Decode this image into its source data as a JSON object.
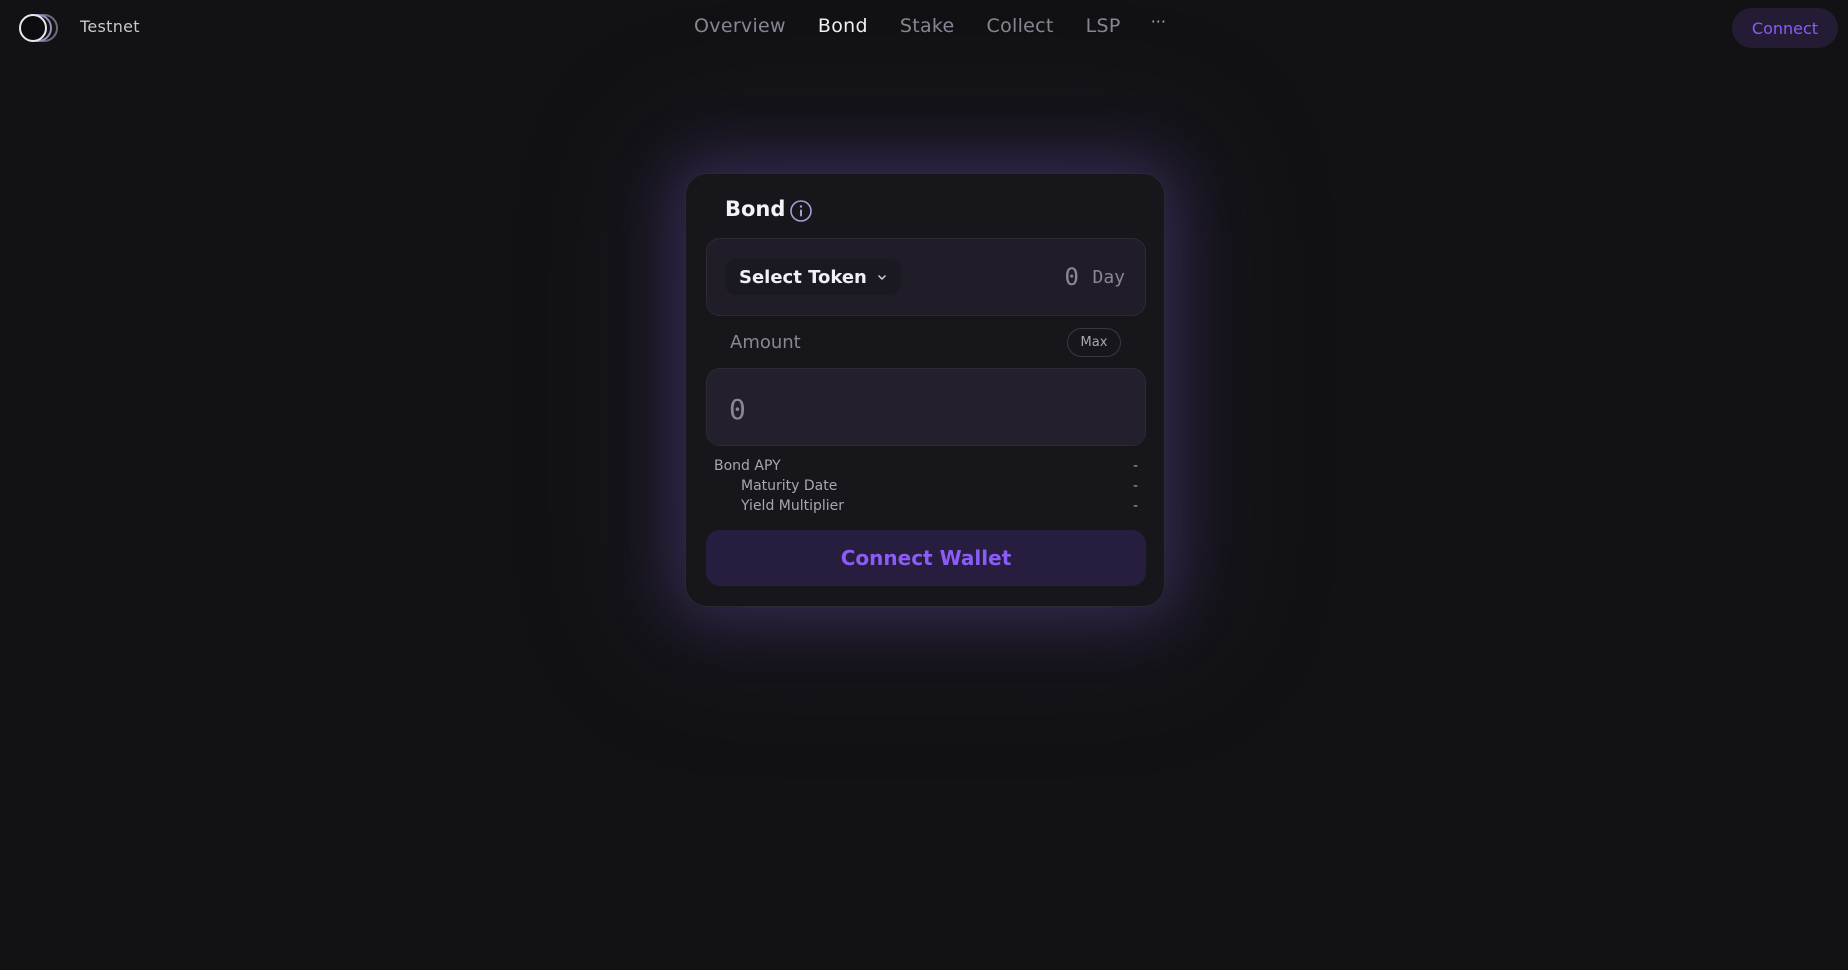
{
  "header": {
    "brand": "Testnet",
    "nav": [
      "Overview",
      "Bond",
      "Stake",
      "Collect",
      "LSP"
    ],
    "more": "···",
    "connect_label": "Connect"
  },
  "card": {
    "title": "Bond",
    "select_token_label": "Select Token",
    "day_value": "0",
    "day_unit": "Day",
    "amount_label": "Amount",
    "max_label": "Max",
    "amount_placeholder": "0",
    "stats": [
      {
        "label": "Bond APY",
        "value": "-"
      },
      {
        "label": "Maturity Date",
        "value": "-"
      },
      {
        "label": "Yield Multiplier",
        "value": "-"
      }
    ],
    "connect_wallet_label": "Connect Wallet"
  },
  "colors": {
    "background": "#121214",
    "card": "#17161b",
    "accent": "#8b5cf6",
    "button_bg": "#271d3e"
  },
  "icons": [
    "app-logo-icon",
    "info-icon",
    "chevron-down-icon"
  ]
}
